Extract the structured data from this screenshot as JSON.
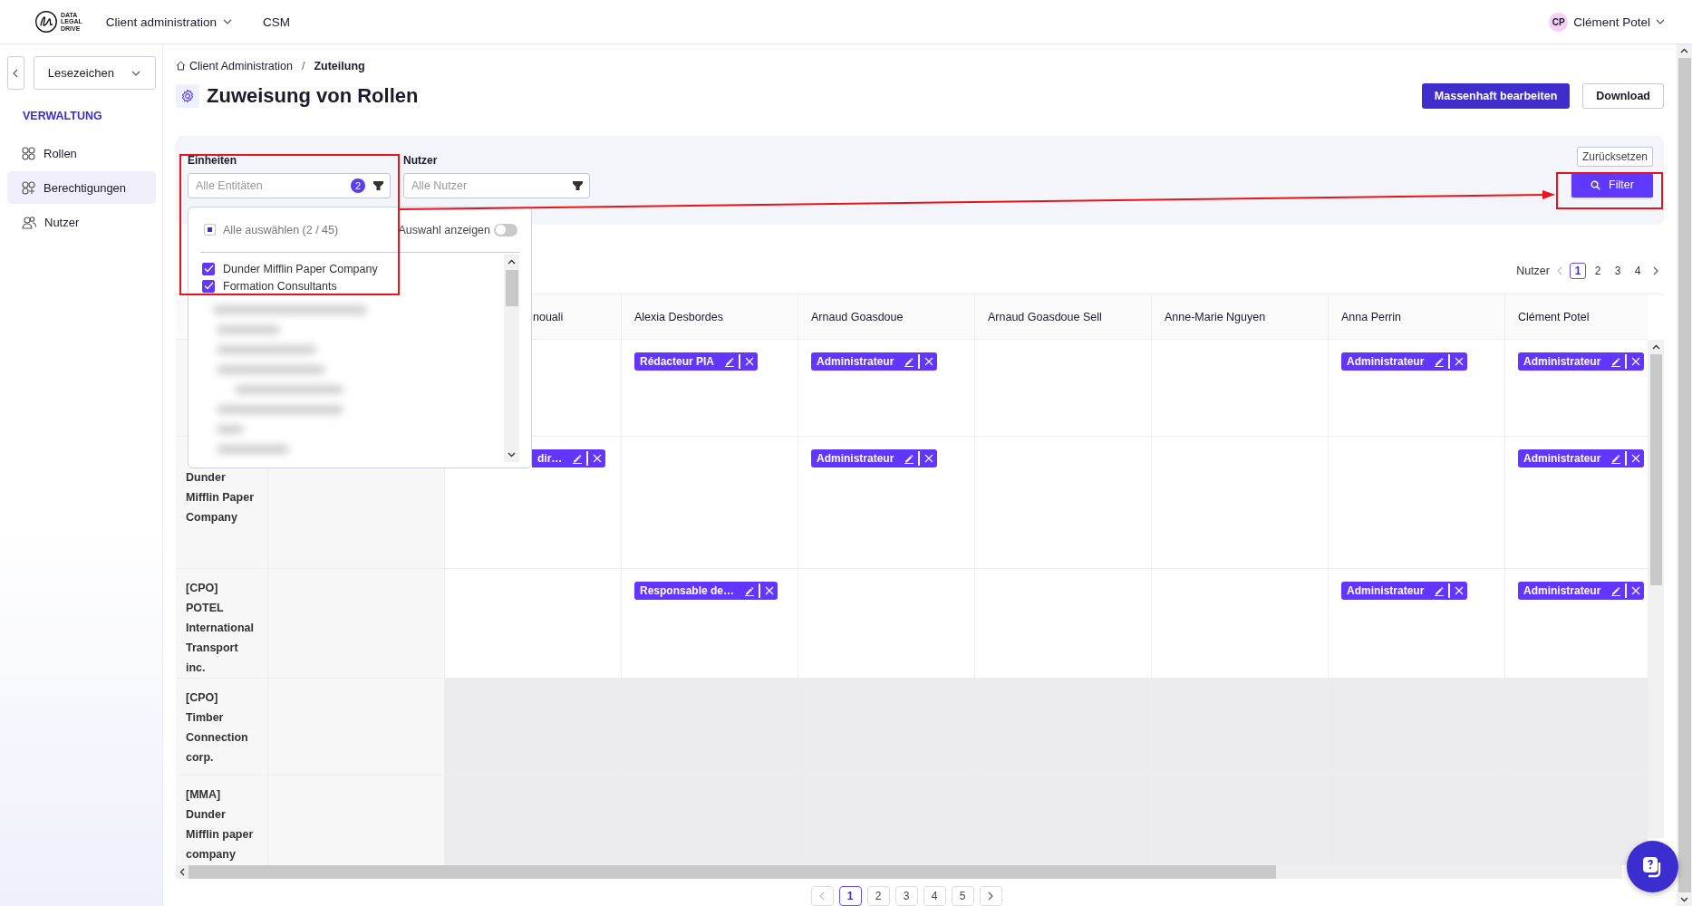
{
  "topbar": {
    "logo_lines": [
      "DATA",
      "LEGAL",
      "DRIVE"
    ],
    "menus": [
      {
        "label": "Client administration",
        "dropdown": true
      },
      {
        "label": "CSM",
        "dropdown": false
      }
    ],
    "user": {
      "initials": "CP",
      "name": "Clément Potel"
    }
  },
  "sidebar": {
    "bookmarks": "Lesezeichen",
    "section": "VERWALTUNG",
    "items": [
      {
        "label": "Rollen",
        "selected": false
      },
      {
        "label": "Berechtigungen",
        "selected": true
      },
      {
        "label": "Nutzer",
        "selected": false
      }
    ]
  },
  "breadcrumb": {
    "items": [
      "Client Administration",
      "Zuteilung"
    ],
    "separator": "/"
  },
  "title": "Zuweisung von Rollen",
  "actions": [
    {
      "label": "Massenhaft bearbeiten",
      "kind": "primary"
    },
    {
      "label": "Download",
      "kind": "secondary"
    }
  ],
  "filters": {
    "fields": [
      {
        "label": "Einheiten",
        "placeholder": "Alle Entitäten",
        "count": "2"
      },
      {
        "label": "Nutzer",
        "placeholder": "Alle Nutzer"
      }
    ],
    "reset": "Zurücksetzen",
    "submit": "Filter"
  },
  "dropdown": {
    "select_all": {
      "label": "Alle auswählen (2 / 45)",
      "indeterminate": true
    },
    "show_selection": {
      "label": "Auswahl anzeigen",
      "on": false
    },
    "options": [
      {
        "label": "Dunder Mifflin Paper Company",
        "checked": true
      },
      {
        "label": "Formation Consultants",
        "checked": true
      }
    ]
  },
  "user_pager": {
    "label": "Nutzer",
    "pages": [
      {
        "label": "1",
        "selected": true
      },
      {
        "label": "2",
        "selected": false
      },
      {
        "label": "3",
        "selected": false
      },
      {
        "label": "4",
        "selected": false
      }
    ]
  },
  "table": {
    "columns": [
      null,
      null,
      {
        "label": "nouali",
        "partial": true
      },
      {
        "label": "Alexia Desbordes",
        "partial": false
      },
      {
        "label": "Arnaud Goasdoue",
        "partial": false
      },
      {
        "label": "Arnaud Goasdoue Sell",
        "partial": false
      },
      {
        "label": "Anne-Marie Nguyen",
        "partial": false
      },
      {
        "label": "Anna Perrin",
        "partial": false
      },
      {
        "label": "Clément Potel",
        "partial": false
      }
    ],
    "rows": [
      {
        "entity_partial": false,
        "disabled": false,
        "cells": [
          null,
          null,
          null,
          {
            "role": "Rédacteur PIA",
            "partial": false
          },
          {
            "role": "Administrateur",
            "partial": false
          },
          null,
          null,
          {
            "role": "Administrateur",
            "partial": false
          },
          {
            "role": "Administrateur",
            "partial": false
          }
        ]
      },
      {
        "entity_partial": true,
        "disabled": false,
        "cells": [
          "Dunder Mifflin Paper Company",
          null,
          {
            "role": "dir…",
            "partial": true
          },
          null,
          {
            "role": "Administrateur",
            "partial": false
          },
          null,
          null,
          null,
          {
            "role": "Administrateur",
            "partial": false
          }
        ]
      },
      {
        "entity_partial": false,
        "disabled": false,
        "cells": [
          "[CPO] POTEL International Transport inc.",
          null,
          null,
          {
            "role": "Responsable de…",
            "partial": false
          },
          null,
          null,
          null,
          {
            "role": "Administrateur",
            "partial": false
          },
          {
            "role": "Administrateur",
            "partial": false
          }
        ]
      },
      {
        "entity_partial": false,
        "disabled": true,
        "cells": [
          "[CPO] Timber Connection corp.",
          null,
          null,
          null,
          null,
          null,
          null,
          null,
          null
        ]
      },
      {
        "entity_partial": false,
        "disabled": true,
        "cells": [
          "[MMA] Dunder Mifflin paper company",
          null,
          null,
          null,
          null,
          null,
          null,
          null,
          null
        ]
      }
    ]
  },
  "bottom_pager": {
    "pages": [
      {
        "label": "1",
        "selected": true
      },
      {
        "label": "2",
        "selected": false
      },
      {
        "label": "3",
        "selected": false
      },
      {
        "label": "4",
        "selected": false
      },
      {
        "label": "5",
        "selected": false
      }
    ]
  }
}
